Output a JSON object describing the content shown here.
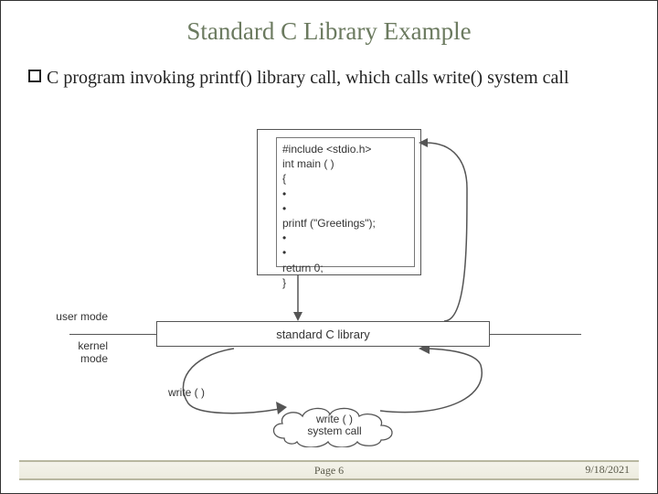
{
  "title": "Standard C Library Example",
  "bullet": "C program invoking printf() library call, which calls write() system call",
  "code": {
    "l1": "#include <stdio.h>",
    "l2": "int main ( )",
    "l3": "{",
    "l4": "•",
    "l5": "•",
    "l6": "printf (\"Greetings\");",
    "l7": "•",
    "l8": "•",
    "l9": "return 0;",
    "l10": "}"
  },
  "std_c_label": "standard C library",
  "user_mode": "user mode",
  "kernel_mode": "kernel mode",
  "write_label": "write ( )",
  "cloud_l1": "write ( )",
  "cloud_l2": "system call",
  "page": "Page 6",
  "date": "9/18/2021"
}
